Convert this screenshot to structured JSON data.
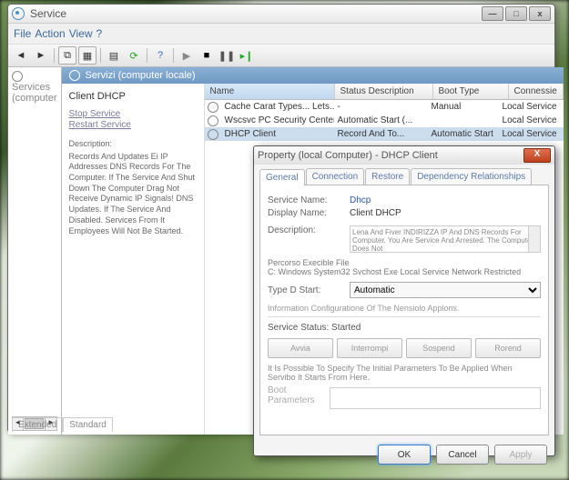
{
  "window": {
    "title": "Service",
    "menu": {
      "file": "File",
      "action": "Action",
      "view": "View",
      "help": "?"
    },
    "buttons": {
      "min": "—",
      "max": "□",
      "close": "x"
    }
  },
  "tree": {
    "root": "Services (computer"
  },
  "header": {
    "title": "Servizi (computer locale)"
  },
  "detail": {
    "title": "Client DHCP",
    "stop": "Stop Service",
    "restart": "Restart Service",
    "descLabel": "Description:",
    "desc": "Records And Updates Ei IP Addresses DNS Records For The Computer. If The Service And Shut Down The Computer Drag Not Receive Dynamic IP Signals! DNS Updates. If The Service And Disabled. Services From It Employees Will Not Be Started."
  },
  "columns": {
    "name": "Name",
    "status": "Status Description",
    "boot": "Boot Type",
    "conn": "Connessie"
  },
  "rows": [
    {
      "name": "Cache Carat Types... Lets...",
      "status": "-",
      "boot": "Manual",
      "conn": "Local Service"
    },
    {
      "name": "Wscsvc PC Security Center (C..",
      "status": "Automatic Start (...",
      "boot": "",
      "conn": "Local Service"
    },
    {
      "name": "DHCP Client",
      "status": "Record And To...",
      "boot": "Automatic Start",
      "conn": "Local Service"
    }
  ],
  "tabs": {
    "ext": "Extended",
    "std": "Standard"
  },
  "dialog": {
    "title": "Property (local Computer) - DHCP Client",
    "tabs": {
      "general": "General",
      "conn": "Connection",
      "restore": "Restore",
      "dep": "Dependency Relationships"
    },
    "serviceNameLabel": "Service Name:",
    "serviceName": "Dhcp",
    "displayNameLabel": "Display Name:",
    "displayName": "Client DHCP",
    "descLabel": "Description:",
    "descText": "Lena And Fiver INDIRIZZA IP And DNS Records For Computer. You Are Service And Arrested. The Computer Does Not",
    "pathLabel": "Percorso Execible File",
    "path": "C: Windows System32 Svchost Exe Local Service Network Restricted",
    "startTypeLabel": "Type D Start:",
    "startType": "Automatic",
    "info": "Information Configuratione Of The Nensiolo Applons.",
    "statusLabel": "Service Status:",
    "status": "Started",
    "btns": {
      "start": "Avvia",
      "stop": "Interrompi",
      "pause": "Sospend",
      "resume": "Rorend"
    },
    "note": "It Is Possible To Specify The Initial Parameters To Be Applied When Servibo It Starts From Here.",
    "bootParamLabel": "Boot Parameters",
    "ok": "OK",
    "cancel": "Cancel",
    "apply": "Apply"
  }
}
